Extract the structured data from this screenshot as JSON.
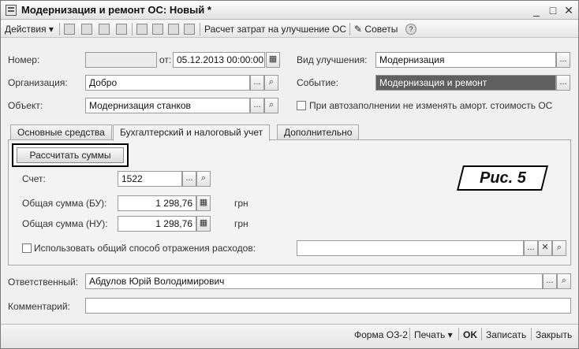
{
  "window": {
    "title": "Модернизация и ремонт ОС: Новый *",
    "min_symbol": "_",
    "max_symbol": "□",
    "close_symbol": "✕"
  },
  "toolbar": {
    "actions_label": "Действия",
    "dropdown_arrow": "▾",
    "calc_costs_label": "Расчет затрат на улучшение ОС",
    "tips_label": "Советы",
    "help_symbol": "?"
  },
  "form": {
    "number_label": "Номер:",
    "number_value": "",
    "date_label": "от:",
    "date_value": "05.12.2013 00:00:00",
    "improvement_type_label": "Вид улучшения:",
    "improvement_type_value": "Модернизация",
    "organization_label": "Организация:",
    "organization_value": "Добро",
    "event_label": "Событие:",
    "event_value": "Модернизация и ремонт",
    "object_label": "Объект:",
    "object_value": "Модернизация станков",
    "autofill_checkbox_label": "При автозаполнении не изменять аморт. стоимость ОС"
  },
  "tabs": [
    {
      "label": "Основные средства"
    },
    {
      "label": "Бухгалтерский и налоговый учет"
    },
    {
      "label": "Дополнительно"
    }
  ],
  "accounting": {
    "calc_button_label": "Рассчитать суммы",
    "account_label": "Счет:",
    "account_value": "1522",
    "total_bu_label": "Общая сумма (БУ):",
    "total_bu_value": "1 298,76",
    "total_nu_label": "Общая сумма (НУ):",
    "total_nu_value": "1 298,76",
    "currency": "грн",
    "common_expense_label": "Использовать общий способ отражения расходов:",
    "common_expense_value": ""
  },
  "figure_label": "Рис. 5",
  "footer_fields": {
    "responsible_label": "Ответственный:",
    "responsible_value": "Абдулов Юрій Володимирович",
    "comment_label": "Комментарий:",
    "comment_value": ""
  },
  "bottom": {
    "form_label": "Форма ОЗ-2",
    "print_label": "Печать",
    "ok_label": "OK",
    "save_label": "Записать",
    "close_label": "Закрыть"
  },
  "glyphs": {
    "ellipsis": "...",
    "search": "🔍",
    "clear": "✕"
  },
  "colors": {
    "selected_field_bg": "#5f5f5f",
    "window_bg": "#f0f0f0"
  }
}
